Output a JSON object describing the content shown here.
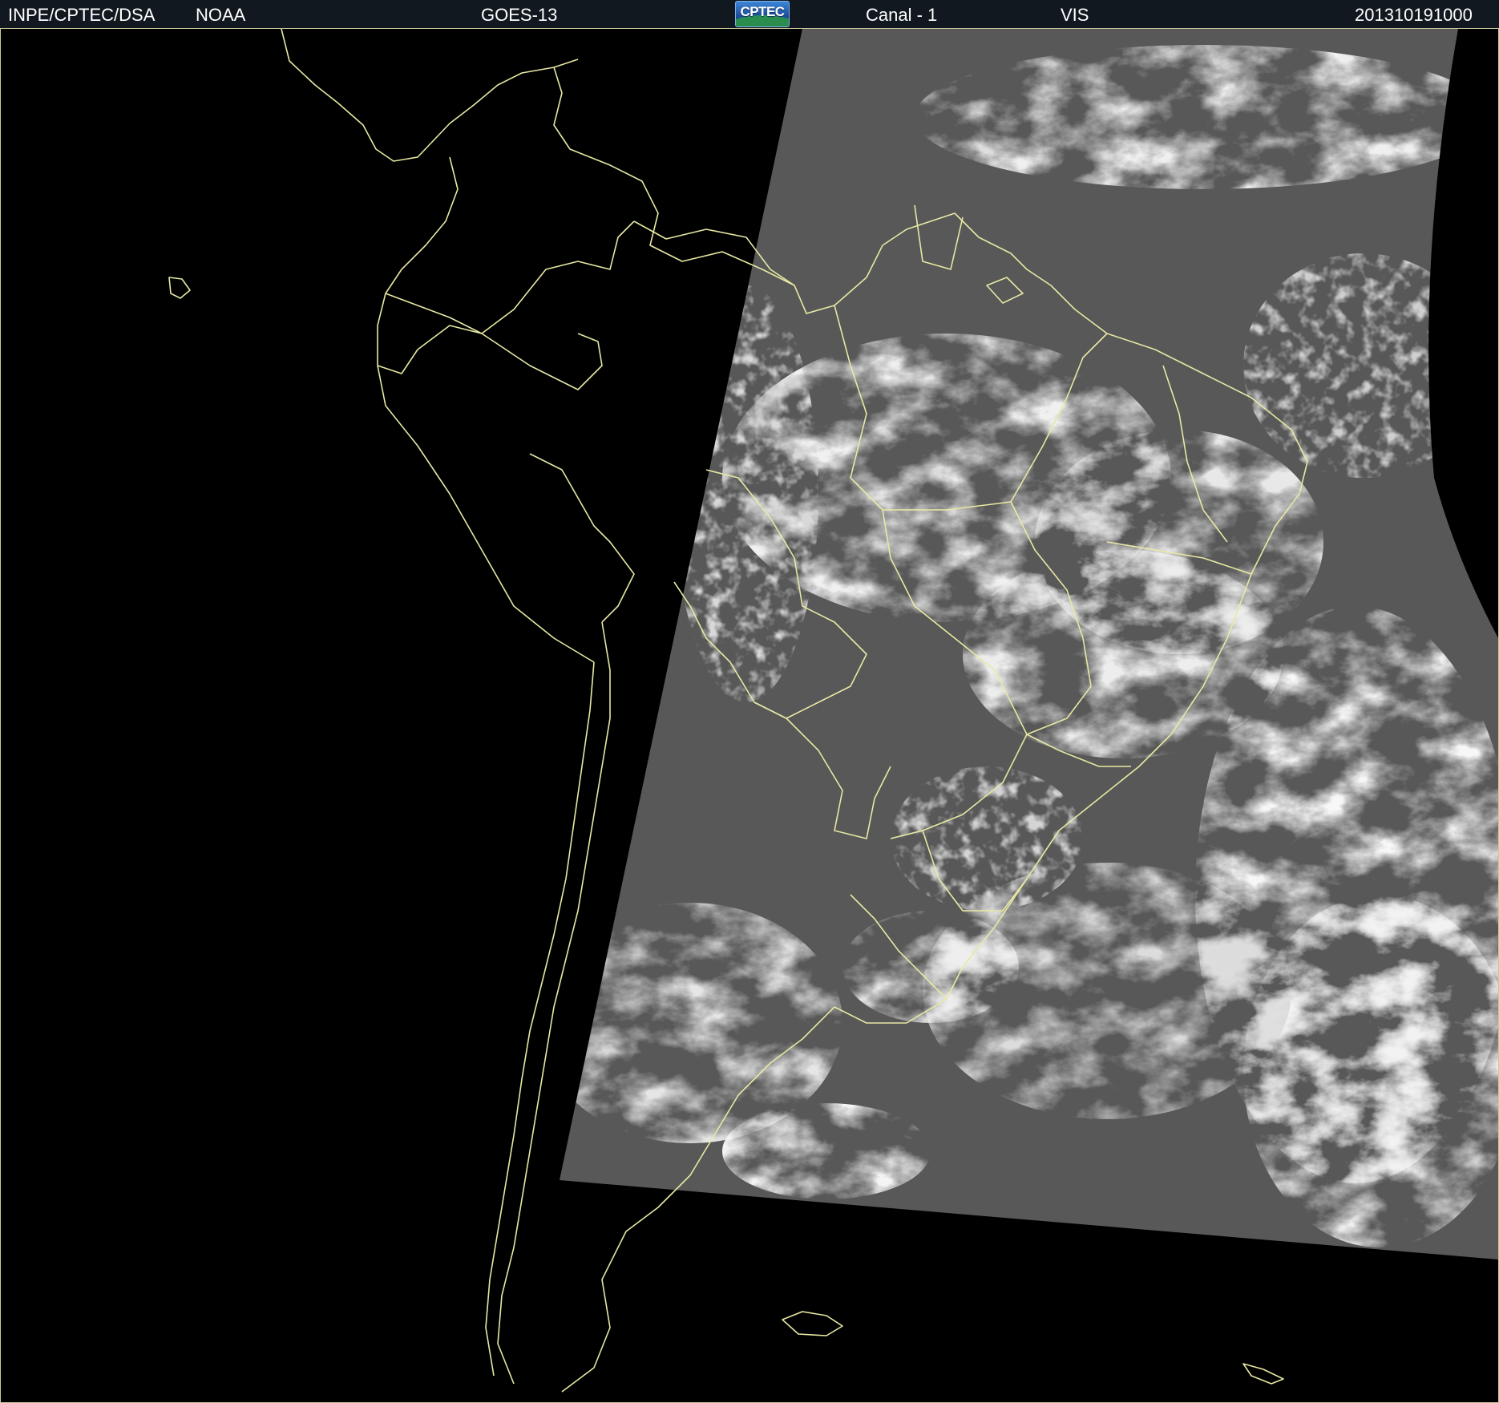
{
  "header": {
    "institution": "INPE/CPTEC/DSA",
    "agency": "NOAA",
    "satellite": "GOES-13",
    "logo_text": "CPTEC",
    "channel": "Canal - 1",
    "band": "VIS",
    "datetime": "201310191000"
  },
  "colors": {
    "header_background": "#11181f",
    "header_text": "#ffffff",
    "map_border_lines": "#e8e8a4",
    "space_background": "#000000",
    "cloud_bright": "#f2f2f2",
    "surface_gray": "#5a5a5a"
  },
  "map": {
    "projection_view": "full-disk sector, South America",
    "illumination": "partial (terminator line)",
    "icons": [
      "cptec-logo-icon"
    ]
  }
}
